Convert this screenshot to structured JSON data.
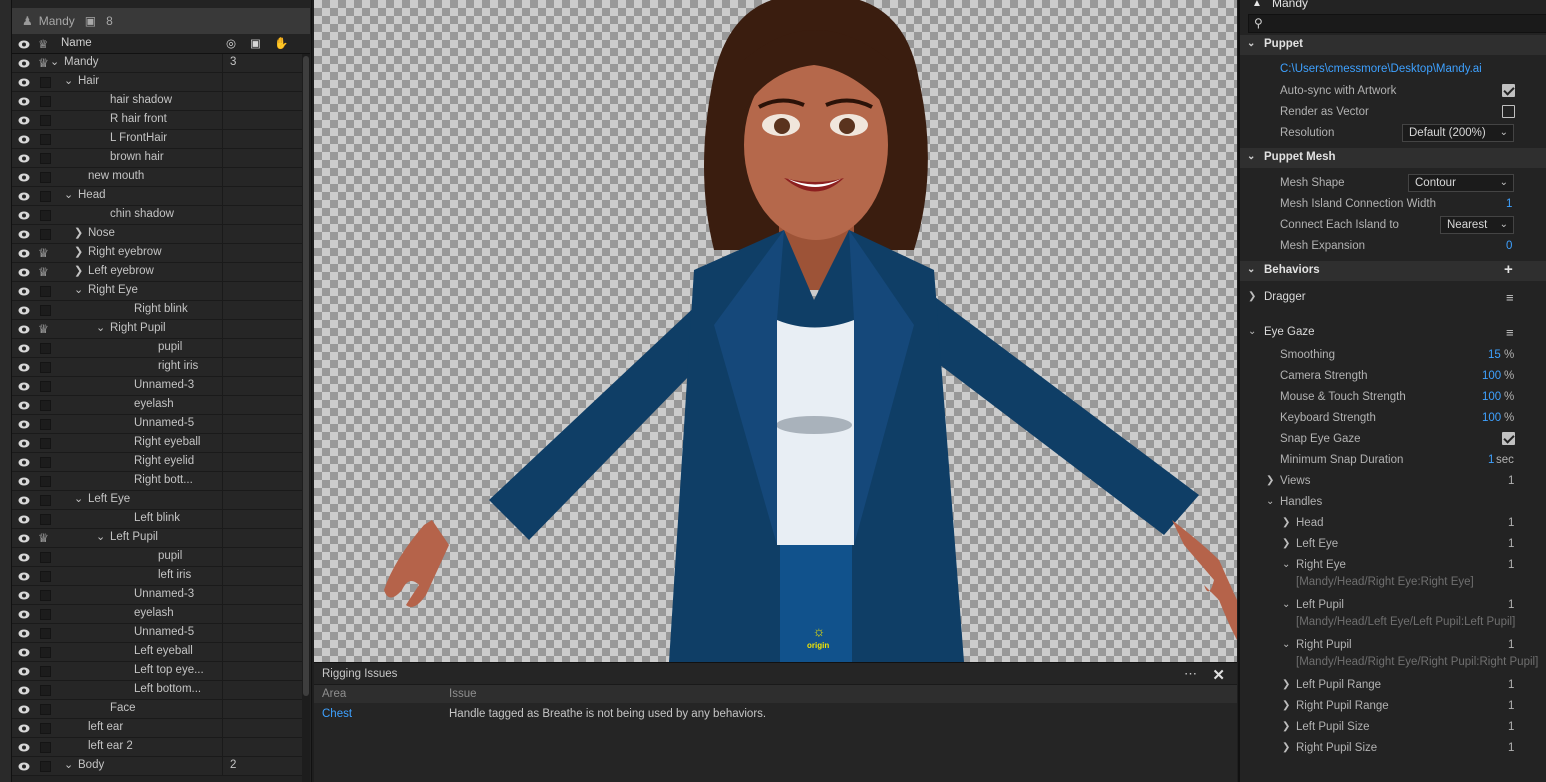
{
  "layers": {
    "header": {
      "name": "Mandy",
      "count": "8"
    },
    "column_name": "Name",
    "rows": [
      {
        "label": "Mandy",
        "indent": 0,
        "twisty": "open",
        "crown": true,
        "count": "3"
      },
      {
        "label": "Hair",
        "indent": 1,
        "twisty": "open",
        "crown": false
      },
      {
        "label": "hair shadow",
        "indent": 3,
        "twisty": "",
        "crown": false
      },
      {
        "label": "R hair front",
        "indent": 3,
        "twisty": "",
        "crown": false
      },
      {
        "label": "L FrontHair",
        "indent": 3,
        "twisty": "",
        "crown": false
      },
      {
        "label": "brown hair",
        "indent": 3,
        "twisty": "",
        "crown": false
      },
      {
        "label": "new mouth",
        "indent": 2,
        "twisty": "",
        "crown": false
      },
      {
        "label": "Head",
        "indent": 1,
        "twisty": "open",
        "crown": false
      },
      {
        "label": "chin shadow",
        "indent": 3,
        "twisty": "",
        "crown": false
      },
      {
        "label": "Nose",
        "indent": 2,
        "twisty": "closed",
        "crown": false
      },
      {
        "label": "Right eyebrow",
        "indent": 2,
        "twisty": "closed",
        "crown": true
      },
      {
        "label": "Left eyebrow",
        "indent": 2,
        "twisty": "closed",
        "crown": true
      },
      {
        "label": "Right Eye",
        "indent": 2,
        "twisty": "open",
        "crown": false
      },
      {
        "label": "Right blink",
        "indent": 4,
        "twisty": "",
        "crown": false
      },
      {
        "label": "Right Pupil",
        "indent": 3,
        "twisty": "open",
        "crown": true
      },
      {
        "label": "pupil",
        "indent": 5,
        "twisty": "",
        "crown": false
      },
      {
        "label": "right iris",
        "indent": 5,
        "twisty": "",
        "crown": false
      },
      {
        "label": "Unnamed-3",
        "indent": 4,
        "twisty": "",
        "crown": false
      },
      {
        "label": "eyelash",
        "indent": 4,
        "twisty": "",
        "crown": false
      },
      {
        "label": "Unnamed-5",
        "indent": 4,
        "twisty": "",
        "crown": false
      },
      {
        "label": "Right eyeball",
        "indent": 4,
        "twisty": "",
        "crown": false
      },
      {
        "label": "Right eyelid",
        "indent": 4,
        "twisty": "",
        "crown": false
      },
      {
        "label": "Right bott...",
        "indent": 4,
        "twisty": "",
        "crown": false
      },
      {
        "label": "Left Eye",
        "indent": 2,
        "twisty": "open",
        "crown": false
      },
      {
        "label": "Left blink",
        "indent": 4,
        "twisty": "",
        "crown": false
      },
      {
        "label": "Left Pupil",
        "indent": 3,
        "twisty": "open",
        "crown": true
      },
      {
        "label": "pupil",
        "indent": 5,
        "twisty": "",
        "crown": false
      },
      {
        "label": "left iris",
        "indent": 5,
        "twisty": "",
        "crown": false
      },
      {
        "label": "Unnamed-3",
        "indent": 4,
        "twisty": "",
        "crown": false
      },
      {
        "label": "eyelash",
        "indent": 4,
        "twisty": "",
        "crown": false
      },
      {
        "label": "Unnamed-5",
        "indent": 4,
        "twisty": "",
        "crown": false
      },
      {
        "label": "Left eyeball",
        "indent": 4,
        "twisty": "",
        "crown": false
      },
      {
        "label": "Left top eye...",
        "indent": 4,
        "twisty": "",
        "crown": false
      },
      {
        "label": "Left bottom...",
        "indent": 4,
        "twisty": "",
        "crown": false
      },
      {
        "label": "Face",
        "indent": 3,
        "twisty": "",
        "crown": false
      },
      {
        "label": "left ear",
        "indent": 2,
        "twisty": "",
        "crown": false
      },
      {
        "label": "left ear 2",
        "indent": 2,
        "twisty": "",
        "crown": false
      },
      {
        "label": "Body",
        "indent": 1,
        "twisty": "open",
        "crown": false,
        "count": "2"
      }
    ]
  },
  "stage": {
    "origin_label": "origin"
  },
  "rigging": {
    "title": "Rigging Issues",
    "col_area": "Area",
    "col_issue": "Issue",
    "issue_area": "Chest",
    "issue_text": "Handle tagged as Breathe is not being used by any behaviors."
  },
  "properties": {
    "title": "Mandy",
    "puppet": {
      "section": "Puppet",
      "path": "C:\\Users\\cmessmore\\Desktop\\Mandy.ai",
      "autosync_label": "Auto-sync with Artwork",
      "autosync": true,
      "vector_label": "Render as Vector",
      "vector": false,
      "resolution_label": "Resolution",
      "resolution_value": "Default (200%)"
    },
    "mesh": {
      "section": "Puppet Mesh",
      "shape_label": "Mesh Shape",
      "shape_value": "Contour",
      "island_width_label": "Mesh Island Connection Width",
      "island_width_value": "1",
      "connect_label": "Connect Each Island to",
      "connect_value": "Nearest",
      "expansion_label": "Mesh Expansion",
      "expansion_value": "0"
    },
    "behaviors": {
      "section": "Behaviors",
      "dragger": "Dragger",
      "eyegaze": "Eye Gaze",
      "smoothing_label": "Smoothing",
      "smoothing_value": "15",
      "pct": "%",
      "camera_label": "Camera Strength",
      "camera_value": "100",
      "mouse_label": "Mouse & Touch Strength",
      "mouse_value": "100",
      "keyboard_label": "Keyboard Strength",
      "keyboard_value": "100",
      "snap_label": "Snap Eye Gaze",
      "snap": true,
      "minsnap_label": "Minimum Snap Duration",
      "minsnap_value": "1",
      "sec": "sec",
      "views_label": "Views",
      "views_count": "1",
      "handles_label": "Handles",
      "handles": [
        {
          "label": "Head",
          "count": "1",
          "open": false,
          "path": ""
        },
        {
          "label": "Left Eye",
          "count": "1",
          "open": false,
          "path": ""
        },
        {
          "label": "Right Eye",
          "count": "1",
          "open": true,
          "path": "[Mandy/Head/Right Eye:Right Eye]"
        },
        {
          "label": "Left Pupil",
          "count": "1",
          "open": true,
          "path": "[Mandy/Head/Left Eye/Left Pupil:Left Pupil]"
        },
        {
          "label": "Right Pupil",
          "count": "1",
          "open": true,
          "path": "[Mandy/Head/Right Eye/Right Pupil:Right Pupil]"
        },
        {
          "label": "Left Pupil Range",
          "count": "1",
          "open": false,
          "path": ""
        },
        {
          "label": "Right Pupil Range",
          "count": "1",
          "open": false,
          "path": ""
        },
        {
          "label": "Left Pupil Size",
          "count": "1",
          "open": false,
          "path": ""
        },
        {
          "label": "Right Pupil Size",
          "count": "1",
          "open": false,
          "path": ""
        }
      ]
    }
  }
}
